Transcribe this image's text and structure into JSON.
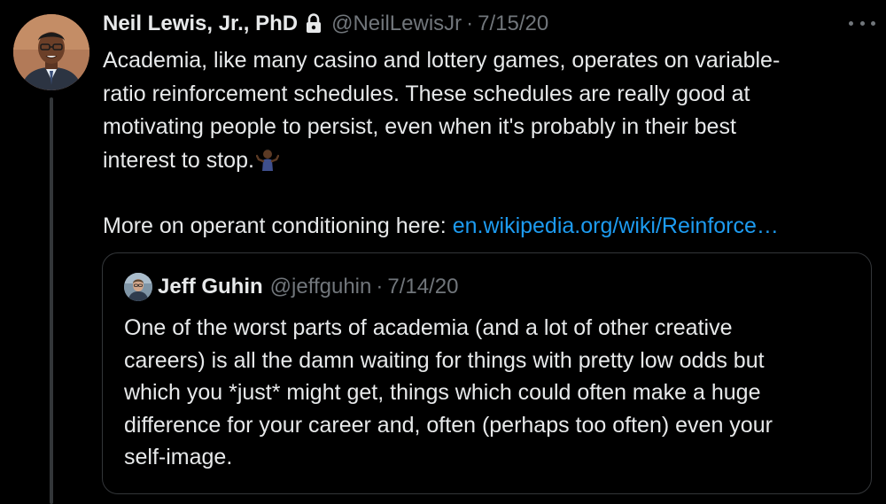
{
  "tweet": {
    "author": {
      "name": "Neil Lewis, Jr., PhD",
      "handle": "@NeilLewisJr",
      "protected": true
    },
    "separator": "·",
    "date": "7/15/20",
    "body_lines": [
      "Academia, like many casino and lottery games, operates on variable-",
      "ratio reinforcement schedules. These schedules are really good at",
      "motivating people to persist, even when it's probably in their best",
      "interest to stop."
    ],
    "emoji": "person-shrugging-emoji",
    "more_prefix": "More on operant conditioning here: ",
    "link_text": "en.wikipedia.org/wiki/Reinforce…",
    "more_icon": "more-icon",
    "lock_icon": "lock-icon"
  },
  "quoted_tweet": {
    "author": {
      "name": "Jeff Guhin",
      "handle": "@jeffguhin"
    },
    "separator": "·",
    "date": "7/14/20",
    "body_lines": [
      "One of the worst parts of academia (and a lot of other creative",
      "careers) is all the damn waiting for things with pretty low odds but",
      "which you *just* might get, things which could often make a huge",
      "difference for your career and, often (perhaps too often) even your",
      "self-image."
    ]
  },
  "colors": {
    "background": "#000000",
    "text": "#e7e9ea",
    "muted": "#71767b",
    "link": "#1d9bf0",
    "border": "#333639"
  }
}
